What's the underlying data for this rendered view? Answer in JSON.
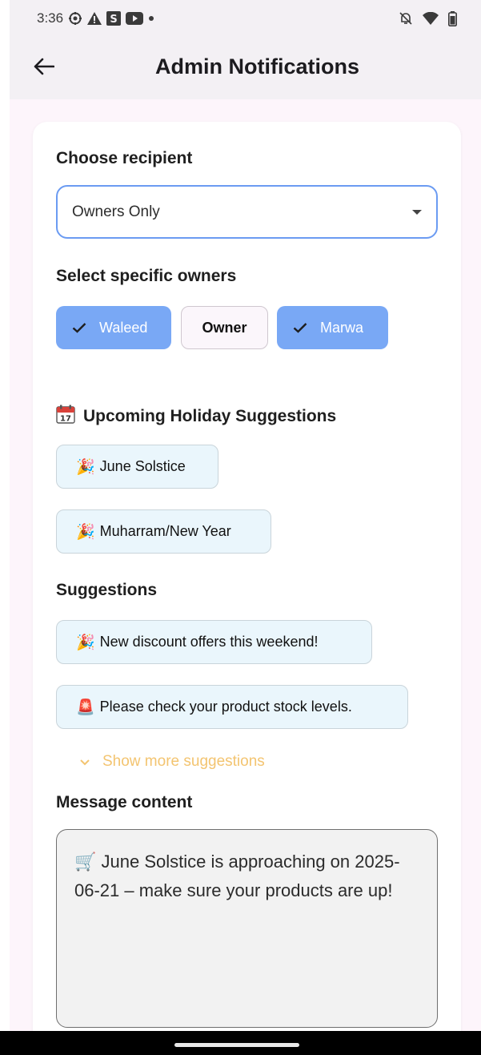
{
  "status_bar": {
    "time": "3:36",
    "icons_left": [
      "gear-icon",
      "warning-icon",
      "s-box-icon",
      "youtube-icon",
      "dot-icon"
    ],
    "icons_right": [
      "bell-off-icon",
      "wifi-icon",
      "battery-icon"
    ]
  },
  "app_bar": {
    "back_icon": "arrow-left-icon",
    "title": "Admin Notifications"
  },
  "recipient": {
    "label": "Choose recipient",
    "selected": "Owners Only"
  },
  "owners": {
    "label": "Select specific owners",
    "chips": [
      {
        "label": "Waleed",
        "selected": true
      },
      {
        "label": "Owner",
        "selected": false
      },
      {
        "label": "Marwa",
        "selected": true
      }
    ]
  },
  "holidays": {
    "label": "Upcoming Holiday Suggestions",
    "icon": "calendar-icon",
    "items": [
      {
        "emoji": "🎉",
        "text": "June Solstice"
      },
      {
        "emoji": "🎉",
        "text": "Muharram/New Year"
      }
    ]
  },
  "suggestions": {
    "label": "Suggestions",
    "items": [
      {
        "emoji": "🎉",
        "text": "New discount offers this weekend!"
      },
      {
        "emoji": "🚨",
        "text": "Please check your product stock levels."
      }
    ],
    "show_more": "Show more suggestions"
  },
  "message": {
    "label": "Message content",
    "value": "🛒 June Solstice is approaching on 2025-06-21 – make sure your products are up!"
  },
  "colors": {
    "accent_blue": "#79a8f5",
    "show_more": "#f3c470",
    "suggestion_bg": "#eaf6fc",
    "background": "#fdf5fb"
  }
}
